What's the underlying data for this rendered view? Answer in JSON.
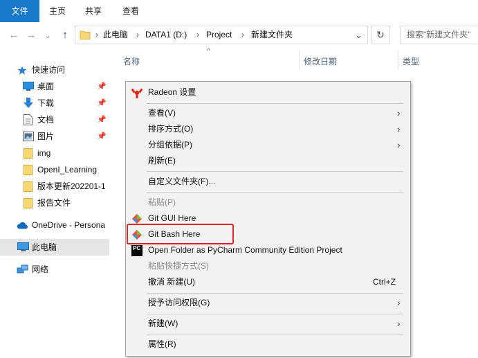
{
  "ribbon": {
    "tabs": [
      {
        "label": "文件",
        "active": true
      },
      {
        "label": "主页",
        "active": false
      },
      {
        "label": "共享",
        "active": false
      },
      {
        "label": "查看",
        "active": false
      }
    ]
  },
  "nav": {
    "back": "←",
    "forward": "→",
    "recent": "⌄",
    "up": "↑",
    "refresh": "↻"
  },
  "address": {
    "crumbs": [
      "此电脑",
      "DATA1 (D:)",
      "Project",
      "新建文件夹"
    ],
    "separator": "›",
    "dropdown": "⌄"
  },
  "search": {
    "placeholder": "搜索\"新建文件夹\""
  },
  "sidebar": {
    "quick_access": "快速访问",
    "items": [
      {
        "label": "桌面",
        "pinned": true
      },
      {
        "label": "下载",
        "pinned": true
      },
      {
        "label": "文档",
        "pinned": true
      },
      {
        "label": "图片",
        "pinned": true
      },
      {
        "label": "img",
        "pinned": false
      },
      {
        "label": "OpenI_Learning",
        "pinned": false
      },
      {
        "label": "版本更新202201-1",
        "pinned": false
      },
      {
        "label": "报告文件",
        "pinned": false
      }
    ],
    "onedrive": "OneDrive - Persona",
    "this_pc": "此电脑",
    "network": "网络"
  },
  "columns": {
    "name": "名称",
    "modified": "修改日期",
    "type": "类型",
    "sort_indicator": "^"
  },
  "context_menu": {
    "radeon": "Radeon 设置",
    "view": "查看(V)",
    "sort": "排序方式(O)",
    "group": "分组依据(P)",
    "refresh": "刷新(E)",
    "customize": "自定义文件夹(F)...",
    "paste": "粘贴(P)",
    "git_gui": "Git GUI Here",
    "git_bash": "Git Bash Here",
    "pycharm": "Open Folder as PyCharm Community Edition Project",
    "paste_shortcut": "粘贴快捷方式(S)",
    "undo": "撤消 新建(U)",
    "undo_shortcut": "Ctrl+Z",
    "grant_access": "授予访问权限(G)",
    "new": "新建(W)",
    "properties": "属性(R)",
    "submenu_arrow": "›",
    "pycharm_icon_text": "PC"
  },
  "colors": {
    "accent": "#1979ca",
    "highlight_border": "#e0262b",
    "radeon_red": "#e2231a",
    "git_orange": "#f05033",
    "folder_yellow": "#f8d775"
  }
}
